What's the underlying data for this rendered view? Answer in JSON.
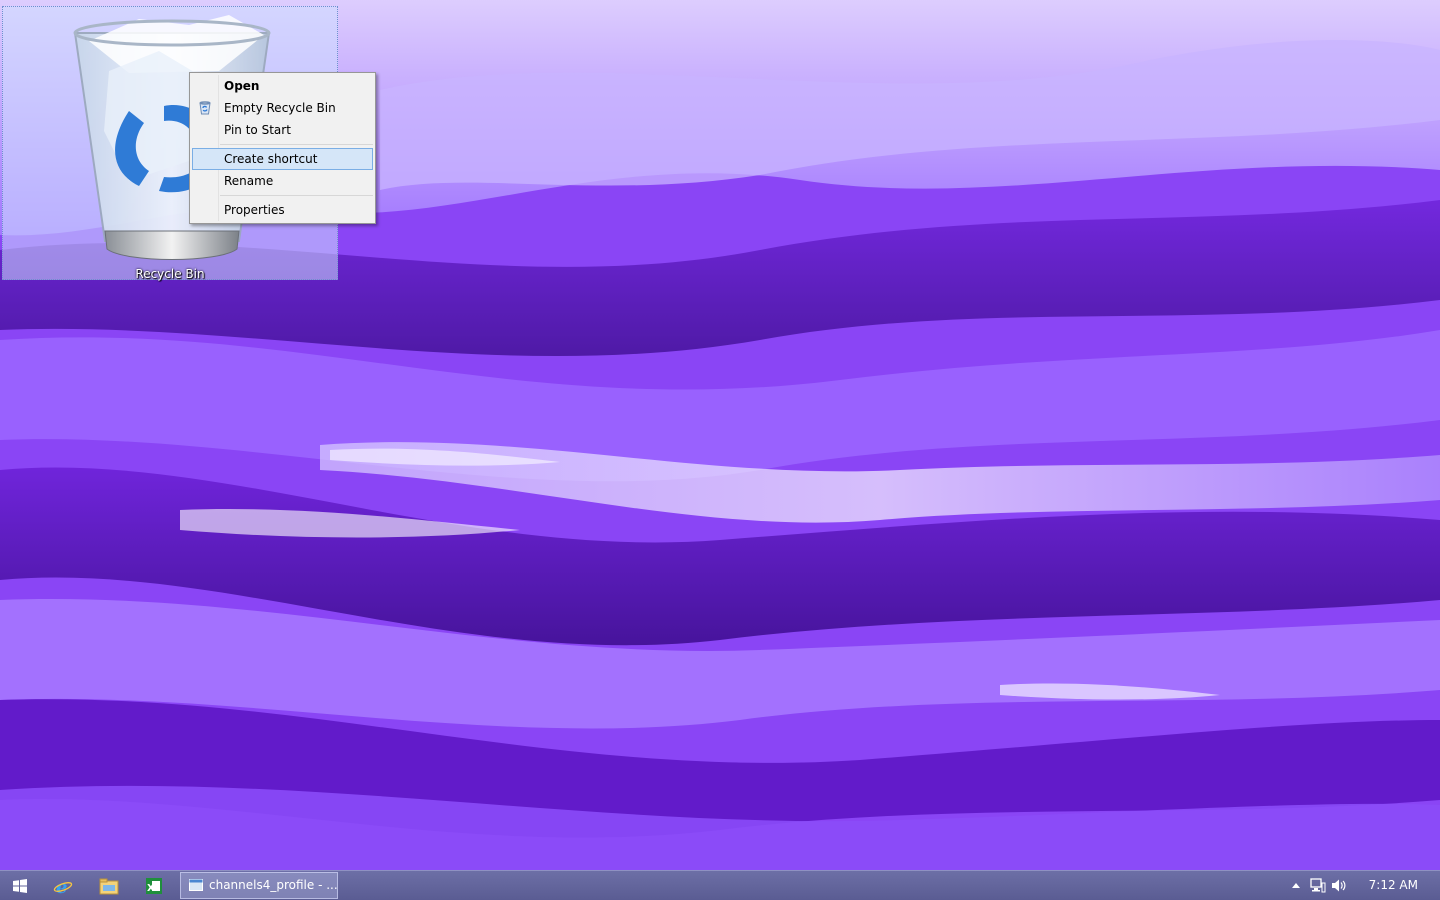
{
  "desktop": {
    "icons": [
      {
        "label": "Recycle Bin"
      }
    ]
  },
  "context_menu": {
    "items": [
      {
        "label": "Open",
        "bold": true
      },
      {
        "label": "Empty Recycle Bin",
        "icon": "recycle-bin-small-icon"
      },
      {
        "label": "Pin to Start"
      },
      {
        "label": "Create shortcut",
        "highlighted": true
      },
      {
        "label": "Rename"
      },
      {
        "label": "Properties"
      }
    ]
  },
  "taskbar": {
    "pinned": [
      {
        "name": "start-button",
        "icon": "windows-logo-icon"
      },
      {
        "name": "internet-explorer",
        "icon": "internet-explorer-icon"
      },
      {
        "name": "file-explorer",
        "icon": "file-explorer-icon"
      },
      {
        "name": "excel",
        "icon": "excel-icon"
      }
    ],
    "window": {
      "title": "channels4_profile - ...",
      "icon": "window-icon"
    },
    "tray": {
      "icons": [
        "show-hidden-icons-arrow",
        "network-icon",
        "volume-icon"
      ],
      "clock": "7:12 AM"
    }
  },
  "colors": {
    "wallpaper_main": "#7b2fe6",
    "taskbar": "#5a5c93",
    "menu_highlight": "#d5e6f8",
    "menu_highlight_border": "#7aaee5"
  }
}
